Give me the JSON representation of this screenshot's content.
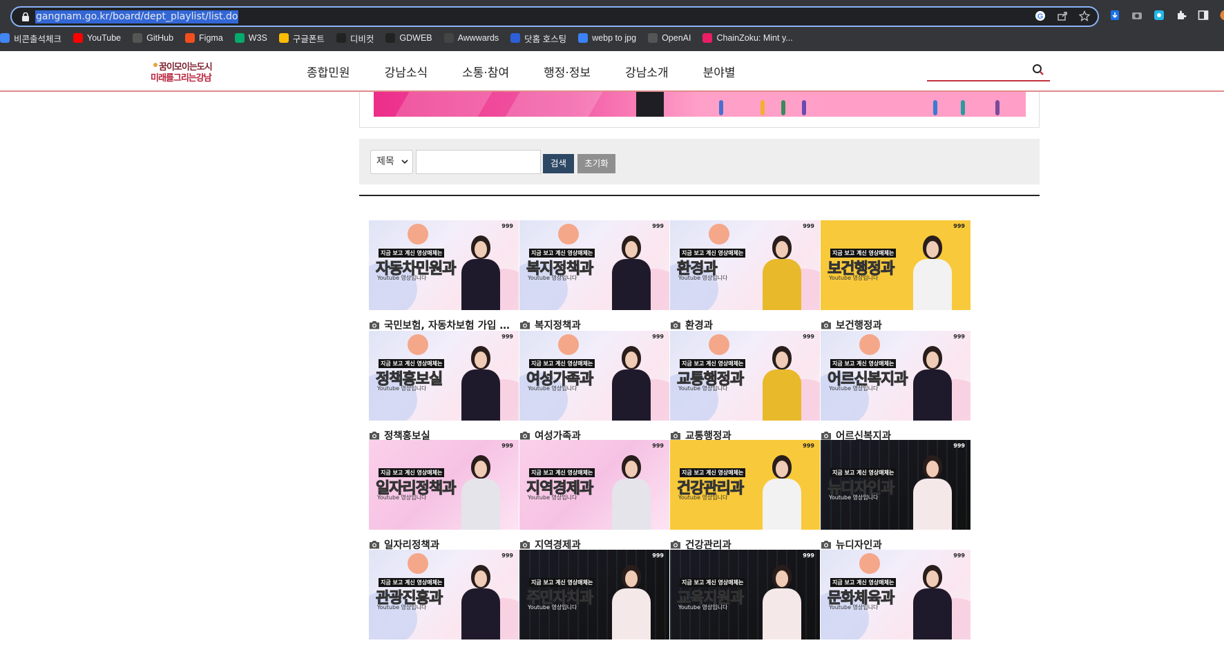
{
  "browser": {
    "url": "gangnam.go.kr/board/dept_playlist/list.do",
    "bookmarks": [
      {
        "label": "비콘출석체크",
        "icon": "google-icon",
        "color": "#4285f4"
      },
      {
        "label": "YouTube",
        "icon": "youtube-icon",
        "color": "#ff0000"
      },
      {
        "label": "GitHub",
        "icon": "github-icon",
        "color": "#555555"
      },
      {
        "label": "Figma",
        "icon": "figma-icon",
        "color": "#f24e1e"
      },
      {
        "label": "W3S",
        "icon": "w3s-icon",
        "color": "#04aa6d"
      },
      {
        "label": "구글폰트",
        "icon": "google-fonts-icon",
        "color": "#fbbc04"
      },
      {
        "label": "디비컷",
        "icon": "dbcut-icon",
        "color": "#222222"
      },
      {
        "label": "GDWEB",
        "icon": "gdweb-icon",
        "color": "#222222"
      },
      {
        "label": "Awwwards",
        "icon": "awwwards-icon",
        "color": "#444444"
      },
      {
        "label": "닷홈 호스팅",
        "icon": "dothome-icon",
        "color": "#2d5fd8"
      },
      {
        "label": "webp to jpg",
        "icon": "webp-icon",
        "color": "#3b82f6"
      },
      {
        "label": "OpenAI",
        "icon": "openai-icon",
        "color": "#555555"
      },
      {
        "label": "ChainZoku: Mint y...",
        "icon": "chainzoku-icon",
        "color": "#e91e63"
      }
    ]
  },
  "header": {
    "logo_line1": "꿈이모이는도시",
    "logo_line2": "미래를그리는강남",
    "nav": [
      "종합민원",
      "강남소식",
      "소통·참여",
      "행정·정보",
      "강남소개",
      "분야별"
    ],
    "search_placeholder": ""
  },
  "search_panel": {
    "select_value": "제목",
    "keyword_value": "",
    "search_label": "검색",
    "reset_label": "초기화"
  },
  "thumb_common": {
    "tagline": "지금 보고 계신 영상매체는",
    "sub": "Youtube 영상입니다",
    "mark": "999"
  },
  "videos": [
    {
      "title": "국민보험, 자동차보험 가입 …",
      "overlay": "자동차민원과",
      "bg": "light",
      "outfit": "#1f1a2b"
    },
    {
      "title": "복지정책과",
      "overlay": "복지정책과",
      "bg": "light",
      "outfit": "#1f1a2b"
    },
    {
      "title": "환경과",
      "overlay": "환경과",
      "bg": "light",
      "outfit": "#e8b92a"
    },
    {
      "title": "보건행정과",
      "overlay": "보건행정과",
      "bg": "yellow",
      "outfit": "#f2f2f2"
    },
    {
      "title": "정책홍보실",
      "overlay": "정책홍보실",
      "bg": "light",
      "outfit": "#1f1a2b"
    },
    {
      "title": "여성가족과",
      "overlay": "여성가족과",
      "bg": "light",
      "outfit": "#1f1a2b"
    },
    {
      "title": "교통행정과",
      "overlay": "교통행정과",
      "bg": "light",
      "outfit": "#e8b92a"
    },
    {
      "title": "어르신복지과",
      "overlay": "어르신복지과",
      "bg": "light",
      "outfit": "#1f1a2b"
    },
    {
      "title": "일자리정책과",
      "overlay": "일자리정책과",
      "bg": "pink",
      "outfit": "#e4e4ea"
    },
    {
      "title": "지역경제과",
      "overlay": "지역경제과",
      "bg": "pink",
      "outfit": "#e4e4ea"
    },
    {
      "title": "건강관리과",
      "overlay": "건강관리과",
      "bg": "yellow",
      "outfit": "#f2f2f2"
    },
    {
      "title": "뉴디자인과",
      "overlay": "뉴디자인과",
      "bg": "dark",
      "outfit": "#f4e8e8"
    },
    {
      "title": "",
      "overlay": "관광진흥과",
      "bg": "light",
      "outfit": "#1f1a2b"
    },
    {
      "title": "",
      "overlay": "주민자치과",
      "bg": "dark",
      "outfit": "#f4e8e8"
    },
    {
      "title": "",
      "overlay": "교육지원과",
      "bg": "dark",
      "outfit": "#f4e8e8"
    },
    {
      "title": "",
      "overlay": "문화체육과",
      "bg": "light",
      "outfit": "#1f1a2b"
    }
  ]
}
